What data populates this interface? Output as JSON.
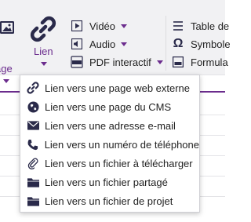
{
  "colors": {
    "accent": "#6b2c8d",
    "ribbon_bg": "#f1f1f3",
    "icon_dark": "#2a2a4a"
  },
  "ribbon": {
    "image_button": {
      "label": "age",
      "icon": "image-icon"
    },
    "link_button": {
      "label": "Lien",
      "icon": "link-icon"
    },
    "middle": [
      {
        "label": "Vidéo",
        "icon": "video-icon"
      },
      {
        "label": "Audio",
        "icon": "audio-icon"
      },
      {
        "label": "PDF interactif",
        "icon": "pdf-icon"
      }
    ],
    "right": [
      {
        "label": "Table de",
        "icon": "table-icon"
      },
      {
        "label": "Symbole",
        "icon": "omega-icon"
      },
      {
        "label": "Formula",
        "icon": "form-icon"
      }
    ]
  },
  "link_menu": {
    "items": [
      {
        "label": "Lien vers une page web externe",
        "icon": "link-icon"
      },
      {
        "label": "Lien vers une page du CMS",
        "icon": "globe-icon"
      },
      {
        "label": "Lien vers une adresse e-mail",
        "icon": "envelope-icon"
      },
      {
        "label": "Lien vers un numéro de téléphone",
        "icon": "phone-icon"
      },
      {
        "label": "Lien vers un fichier à télécharger",
        "icon": "paperclip-icon"
      },
      {
        "label": "Lien vers un fichier partagé",
        "icon": "folder-icon"
      },
      {
        "label": "Lien vers un fichier de projet",
        "icon": "folder-icon"
      }
    ]
  }
}
